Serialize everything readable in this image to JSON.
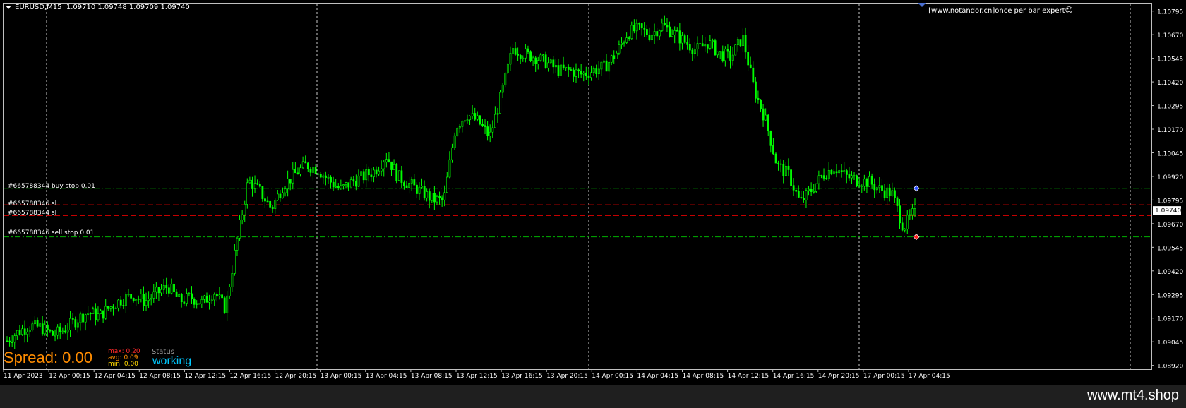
{
  "header": {
    "symbol": "EURUSD,M15",
    "ohlc": "1.09710 1.09748 1.09709 1.09740"
  },
  "expert_label": "[www.notandor.cn]once per bar expert",
  "orders": [
    {
      "label": "#665788344 buy stop 0.01",
      "price": 1.09857,
      "color": "#00b000",
      "style": "dashdot"
    },
    {
      "label": "#665788346 sl",
      "price": 1.0977,
      "color": "#e00000",
      "style": "dashed"
    },
    {
      "label": "#665788344 sl",
      "price": 1.09713,
      "color": "#e00000",
      "style": "dashed"
    },
    {
      "label": "#665788346 sell stop 0.01",
      "price": 1.096,
      "color": "#00b000",
      "style": "dashdot"
    }
  ],
  "current_price": "1.09740",
  "price_axis": {
    "ticks": [
      "1.10795",
      "1.10670",
      "1.10545",
      "1.10420",
      "1.10295",
      "1.10170",
      "1.10045",
      "1.09920",
      "1.09795",
      "1.09670",
      "1.09545",
      "1.09420",
      "1.09295",
      "1.09170",
      "1.09045",
      "1.08920"
    ],
    "top": 1.10835,
    "bottom": 1.089
  },
  "time_axis": {
    "ticks": [
      "11 Apr 2023",
      "12 Apr 00:15",
      "12 Apr 04:15",
      "12 Apr 08:15",
      "12 Apr 12:15",
      "12 Apr 16:15",
      "12 Apr 20:15",
      "13 Apr 00:15",
      "13 Apr 04:15",
      "13 Apr 08:15",
      "13 Apr 12:15",
      "13 Apr 16:15",
      "13 Apr 20:15",
      "14 Apr 00:15",
      "14 Apr 04:15",
      "14 Apr 08:15",
      "14 Apr 12:15",
      "14 Apr 16:15",
      "14 Apr 20:15",
      "17 Apr 00:15",
      "17 Apr 04:15"
    ]
  },
  "spread_panel": {
    "spread_text": "Spread: 0.00",
    "max": "max: 0.20",
    "avg": "avg: 0.09",
    "min": "min: 0.00",
    "status_label": "Status",
    "status_value": "working"
  },
  "footer": "www.mt4.shop",
  "price_path": [
    1.0905,
    1.091,
    1.0913,
    1.0912,
    1.0908,
    1.0911,
    1.0916,
    1.092,
    1.0918,
    1.0923,
    1.0927,
    1.0929,
    1.0926,
    1.093,
    1.0934,
    1.0926,
    1.0928,
    1.0925,
    1.0931,
    1.0922,
    1.0958,
    1.099,
    1.0984,
    1.0975,
    1.0987,
    1.0993,
    1.0998,
    1.0996,
    1.099,
    1.0985,
    1.0989,
    1.0992,
    1.0995,
    1.1003,
    1.0992,
    1.0988,
    1.0984,
    1.098,
    1.0979,
    1.1018,
    1.1025,
    1.1021,
    1.1013,
    1.1035,
    1.106,
    1.1057,
    1.1055,
    1.1052,
    1.1048,
    1.1048,
    1.1046,
    1.1048,
    1.105,
    1.1057,
    1.1068,
    1.107,
    1.1067,
    1.1072,
    1.1068,
    1.1063,
    1.1059,
    1.1063,
    1.1057,
    1.1055,
    1.1066,
    1.1038,
    1.1022,
    1.0998,
    1.0993,
    1.0978,
    1.0985,
    1.0993,
    1.0997,
    1.0992,
    1.099,
    1.0989,
    1.0985,
    1.0983,
    1.0965,
    1.0974
  ]
}
